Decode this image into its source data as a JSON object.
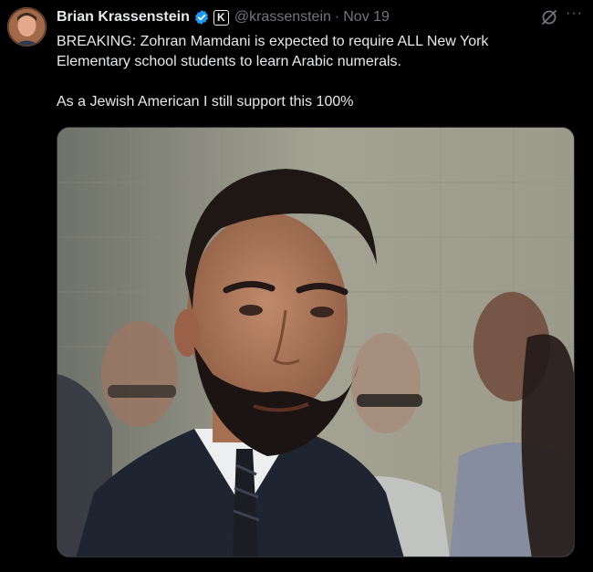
{
  "author": {
    "name": "Brian Krassenstein",
    "handle": "@krassenstein",
    "separator": "·",
    "date": "Nov 19",
    "affiliate_badge": "K",
    "avatar_icon": "profile-photo",
    "verified_icon": "verified-badge-icon"
  },
  "tweet": {
    "line1": "BREAKING: Zohran Mamdani is expected to require ALL New York",
    "line2": "Elementary school students to learn Arabic numerals.",
    "line3": "As a Jewish American I still support this 100%"
  },
  "actions": {
    "grok_icon": "grok-icon",
    "more_icon": "more-options-icon",
    "more_label": "···"
  },
  "colors": {
    "background": "#000000",
    "text": "#e7e9ea",
    "muted": "#71767b",
    "verified": "#1d9bf0"
  }
}
